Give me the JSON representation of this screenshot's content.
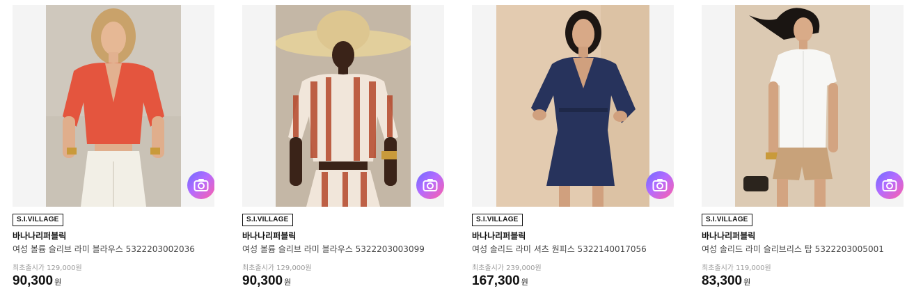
{
  "products": [
    {
      "badge": "S.I.VILLAGE",
      "brand": "바나나리퍼블릭",
      "name": "여성 볼륨 슬리브 라미 블라우스 5322203002036",
      "original_price": "최초출시가 129,000원",
      "price": "90,300",
      "currency": "원",
      "image_icon": "model-red-blouse-photo"
    },
    {
      "badge": "S.I.VILLAGE",
      "brand": "바나나리퍼블릭",
      "name": "여성 볼륨 슬리브 라미 블라우스 5322203003099",
      "original_price": "최초출시가 129,000원",
      "price": "90,300",
      "currency": "원",
      "image_icon": "model-ikat-blouse-hat-photo"
    },
    {
      "badge": "S.I.VILLAGE",
      "brand": "바나나리퍼블릭",
      "name": "여성 솔리드 라미 셔츠 원피스 5322140017056",
      "original_price": "최초출시가 239,000원",
      "price": "167,300",
      "currency": "원",
      "image_icon": "model-navy-dress-photo"
    },
    {
      "badge": "S.I.VILLAGE",
      "brand": "바나나리퍼블릭",
      "name": "여성 솔리드 라미 슬리브리스 탑 5322203005001",
      "original_price": "최초출시가 119,000원",
      "price": "83,300",
      "currency": "원",
      "image_icon": "model-white-top-photo"
    }
  ],
  "colors": {
    "image_bg": "#f4f4f4",
    "camera_gradient": [
      "#6d6bff",
      "#b46bff",
      "#ff5fa8"
    ],
    "price_text": "#111111",
    "original_price_text": "#999999"
  },
  "icons": {
    "camera_button": "camera-search-icon"
  }
}
